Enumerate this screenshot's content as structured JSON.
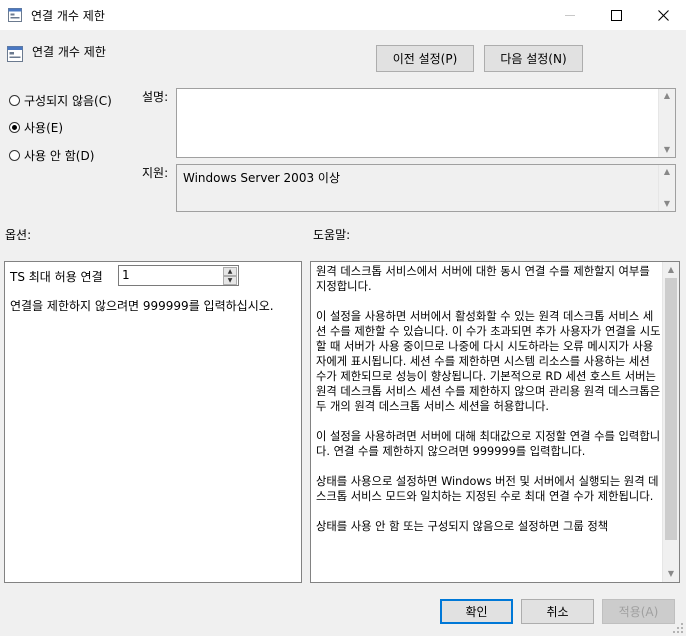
{
  "window": {
    "title": "연결 개수 제한"
  },
  "header": {
    "setting_name": "연결 개수 제한",
    "prev_button": "이전 설정(P)",
    "next_button": "다음 설정(N)"
  },
  "state": {
    "options": [
      {
        "label": "구성되지 않음(C)",
        "selected": false
      },
      {
        "label": "사용(E)",
        "selected": true
      },
      {
        "label": "사용 안 함(D)",
        "selected": false
      }
    ]
  },
  "comment": {
    "label": "설명:",
    "value": ""
  },
  "supported": {
    "label": "지원:",
    "value": "Windows Server 2003 이상"
  },
  "options_section": {
    "label": "옵션:",
    "ts_max_label": "TS 최대 허용 연결",
    "ts_max_value": "1",
    "hint": "연결을 제한하지 않으려면 999999를 입력하십시오."
  },
  "help_section": {
    "label": "도움말:",
    "paragraphs": [
      "원격 데스크톱 서비스에서 서버에 대한 동시 연결 수를 제한할지 여부를 지정합니다.",
      "이 설정을 사용하면 서버에서 활성화할 수 있는 원격 데스크톱 서비스 세션 수를 제한할 수 있습니다. 이 수가 초과되면 추가 사용자가 연결을 시도할 때 서버가 사용 중이므로 나중에 다시 시도하라는 오류 메시지가 사용자에게 표시됩니다. 세션 수를 제한하면 시스템 리소스를 사용하는 세션 수가 제한되므로 성능이 향상됩니다. 기본적으로 RD 세션 호스트 서버는 원격 데스크톱 서비스 세션 수를 제한하지 않으며 관리용 원격 데스크톱은 두 개의 원격 데스크톱 서비스 세션을 허용합니다.",
      "이 설정을 사용하려면 서버에 대해 최대값으로 지정할 연결 수를 입력합니다. 연결 수를 제한하지 않으려면 999999를 입력합니다.",
      "상태를 사용으로 설정하면 Windows 버전 및 서버에서 실행되는 원격 데스크톱 서비스 모드와 일치하는 지정된 수로 최대 연결 수가 제한됩니다.",
      "상태를 사용 안 함 또는 구성되지 않음으로 설정하면 그룹 정책"
    ]
  },
  "footer": {
    "ok": "확인",
    "cancel": "취소",
    "apply": "적용(A)"
  },
  "icons": {
    "title_icon": "policy-setting-icon",
    "setting_icon": "policy-setting-icon",
    "minimize": "minimize-icon",
    "maximize": "maximize-icon",
    "close": "close-icon"
  },
  "colors": {
    "accent": "#0078d7",
    "dialog_bg": "#f0f0f0"
  }
}
